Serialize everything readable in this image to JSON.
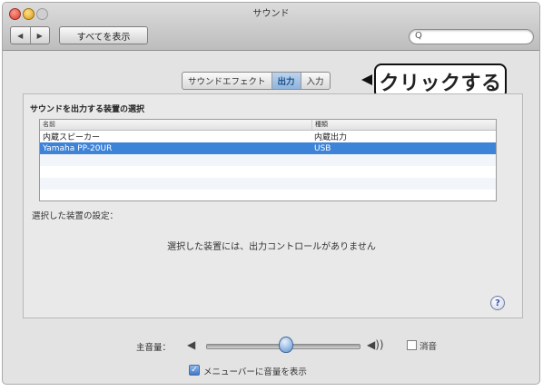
{
  "window": {
    "title": "サウンド"
  },
  "toolbar": {
    "back_icon": "◀",
    "forward_icon": "▶",
    "show_all_label": "すべてを表示",
    "search_placeholder": "",
    "search_icon": "Q"
  },
  "tabs": [
    {
      "label": "サウンドエフェクト",
      "active": false
    },
    {
      "label": "出力",
      "active": true
    },
    {
      "label": "入力",
      "active": false
    }
  ],
  "callout": {
    "text": "クリックする"
  },
  "output": {
    "section_label": "サウンドを出力する装置の選択",
    "columns": {
      "name": "名前",
      "type": "種類"
    },
    "rows": [
      {
        "name": "内蔵スピーカー",
        "type": "内蔵出力",
        "selected": false
      },
      {
        "name": "Yamaha PP-20UR",
        "type": "USB",
        "selected": true
      }
    ],
    "settings_label": "選択した装置の設定：",
    "no_controls_text": "選択した装置には、出力コントロールがありません"
  },
  "help": {
    "icon": "?"
  },
  "volume": {
    "label": "主音量：",
    "level_percent": 51,
    "speaker_low_icon": "◀",
    "speaker_high_icon": "◀))",
    "mute_label": "消音",
    "mute_checked": false
  },
  "menubar": {
    "checked": true,
    "check_glyph": "✓",
    "label": "メニューバーに音量を表示"
  },
  "colors": {
    "accent": "#3d83d8",
    "callout_border": "#111111"
  }
}
